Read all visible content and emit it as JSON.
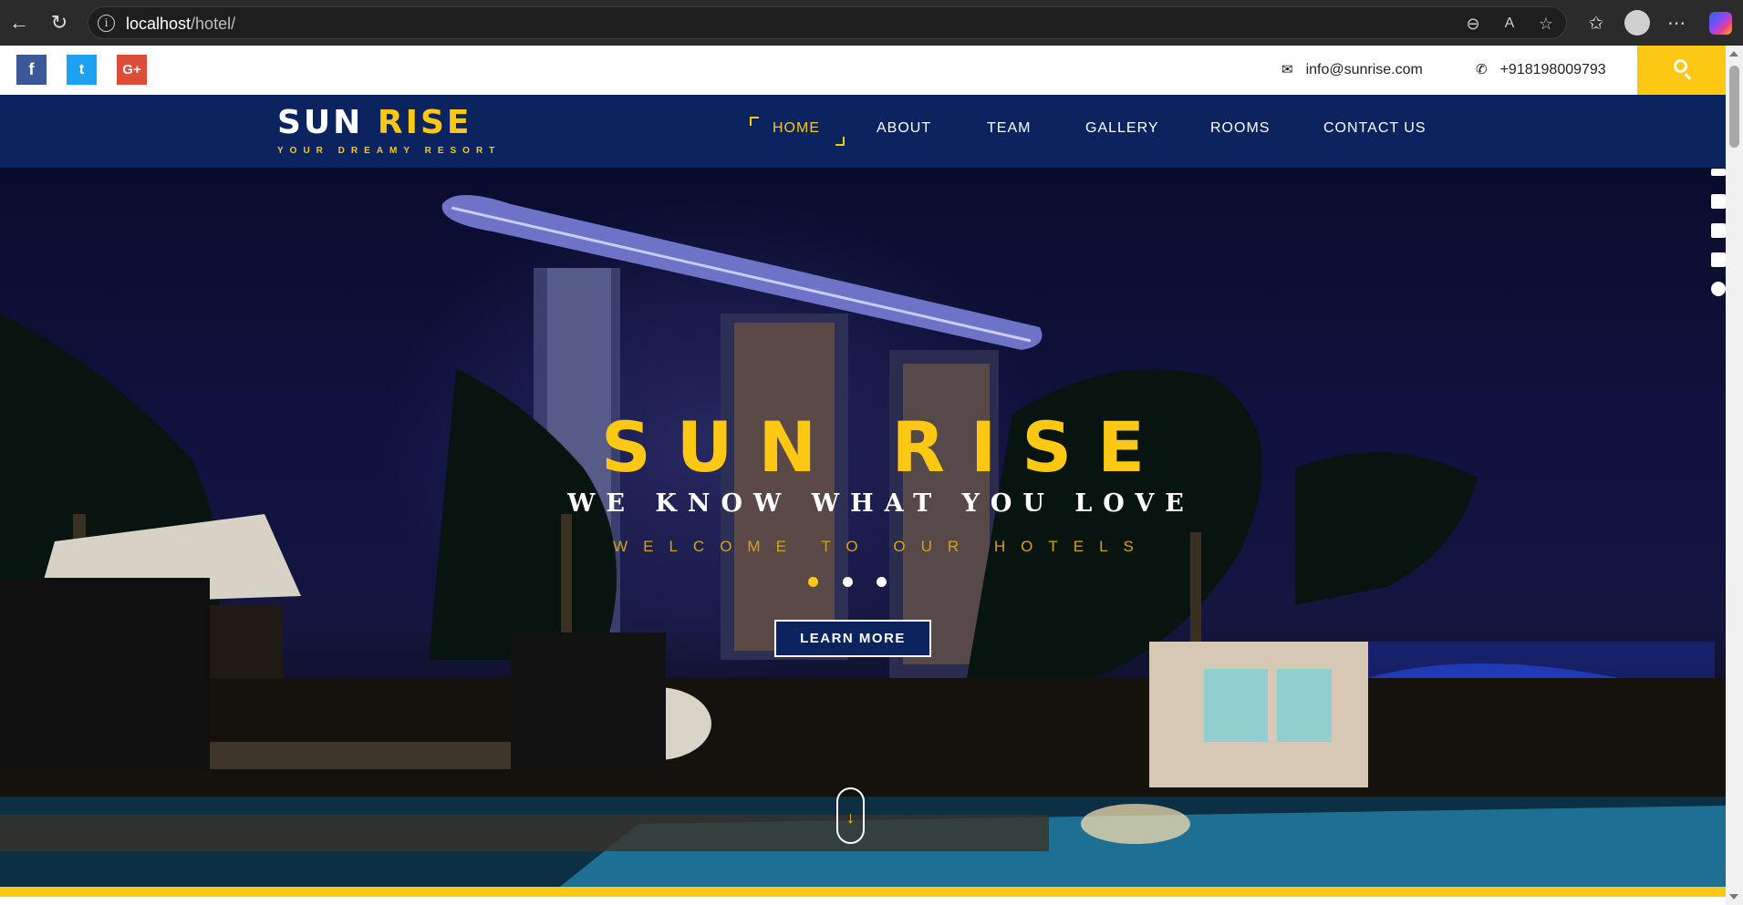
{
  "browser": {
    "url_host": "localhost",
    "url_path": "/hotel/",
    "icons": [
      "back-icon",
      "reload-icon",
      "info-icon",
      "zoom-out-icon",
      "read-aloud-icon",
      "favorite-star-icon",
      "favorites-icon",
      "profile-icon",
      "more-icon",
      "copilot-icon"
    ]
  },
  "topbar": {
    "social": [
      {
        "name": "facebook",
        "glyph": "f"
      },
      {
        "name": "twitter",
        "glyph": "t"
      },
      {
        "name": "google-plus",
        "glyph": "G+"
      }
    ],
    "email": "info@sunrise.com",
    "phone": "+918198009793"
  },
  "brand": {
    "name_part1": "SUN",
    "name_part2": "RISE",
    "tagline": "YOUR DREAMY RESORT"
  },
  "nav": {
    "items": [
      "HOME",
      "ABOUT",
      "TEAM",
      "GALLERY",
      "ROOMS",
      "CONTACT US"
    ],
    "active": "HOME"
  },
  "hero": {
    "title": "SUN RISE",
    "subtitle": "WE KNOW WHAT YOU LOVE",
    "welcome": "WELCOME TO OUR HOTELS",
    "slides_count": 3,
    "active_slide": 1,
    "cta_label": "LEARN MORE",
    "scroll_arrow": "↓"
  },
  "colors": {
    "accent": "#fcc813",
    "navy": "#0b2460",
    "facebook": "#3b5998",
    "twitter": "#1da1f2",
    "google_plus": "#dd4b39"
  }
}
